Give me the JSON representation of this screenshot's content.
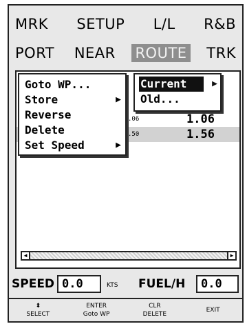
{
  "tabs_row1": [
    "MRK",
    "SETUP",
    "L/L",
    "R&B"
  ],
  "tabs_row2": [
    "PORT",
    "NEAR",
    "ROUTE",
    "TRK"
  ],
  "menu": {
    "items": [
      {
        "label": "Goto WP...",
        "submenu": false
      },
      {
        "label": "Store",
        "submenu": true
      },
      {
        "label": "Reverse",
        "submenu": false
      },
      {
        "label": "Delete",
        "submenu": false
      },
      {
        "label": "Set Speed",
        "submenu": true
      }
    ]
  },
  "submenu": {
    "items": [
      {
        "label": "Current",
        "submenu": true,
        "selected": true
      },
      {
        "label": "Old...",
        "submenu": false,
        "selected": false
      }
    ]
  },
  "rows": [
    {
      "small": ".06",
      "value": "1.06",
      "highlight": false
    },
    {
      "small": ".50",
      "value": "1.56",
      "highlight": true
    }
  ],
  "status": {
    "speed_label": "SPEED",
    "speed_value": "0.0",
    "speed_unit": "KTS",
    "fuel_label": "FUEL/H",
    "fuel_value": "0.0"
  },
  "softkeys": [
    {
      "top": "⬍",
      "bottom": "SELECT"
    },
    {
      "top": "ENTER",
      "bottom": "Goto WP"
    },
    {
      "top": "CLR",
      "bottom": "DELETE"
    },
    {
      "top": "",
      "bottom": "EXIT"
    }
  ]
}
